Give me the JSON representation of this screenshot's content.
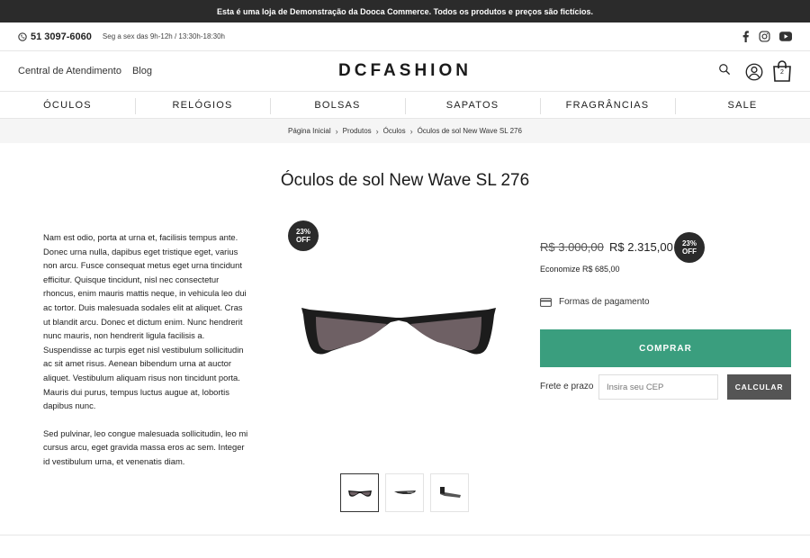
{
  "announcement": "Esta é uma loja de Demonstração da Dooca Commerce. Todos os produtos e preços são fictícios.",
  "contact": {
    "phone": "51 3097-6060",
    "hours": "Seg a sex das 9h-12h / 13:30h-18:30h"
  },
  "header": {
    "links": [
      "Central de Atendimento",
      "Blog"
    ],
    "logo": "DCFASHION",
    "cart_count": "2"
  },
  "nav": [
    "ÓCULOS",
    "RELÓGIOS",
    "BOLSAS",
    "SAPATOS",
    "FRAGRÂNCIAS",
    "SALE"
  ],
  "breadcrumb": [
    "Página Inicial",
    "Produtos",
    "Óculos",
    "Óculos de sol New Wave SL 276"
  ],
  "product": {
    "title": "Óculos de sol New Wave SL 276",
    "description": [
      "Nam est odio, porta at urna et, facilisis tempus ante. Donec urna nulla, dapibus eget tristique eget, varius non arcu. Fusce consequat metus eget urna tincidunt efficitur. Quisque tincidunt, nisl nec consectetur rhoncus, enim mauris mattis neque, in vehicula leo dui ac tortor. Duis malesuada sodales elit at aliquet. Cras ut blandit arcu. Donec et dictum enim. Nunc hendrerit nunc mauris, non hendrerit ligula facilisis a. Suspendisse ac turpis eget nisl vestibulum sollicitudin ac sit amet risus. Aenean bibendum urna at auctor aliquet. Vestibulum aliquam risus non tincidunt porta. Mauris dui purus, tempus luctus augue at, lobortis dapibus nunc.",
      "Sed pulvinar, leo congue malesuada sollicitudin, leo mi cursus arcu, eget gravida massa eros ac sem. Integer id vestibulum urna, et venenatis diam."
    ],
    "discount_percent": "23%",
    "discount_label": "OFF",
    "old_price": "R$ 3.000,00",
    "price": "R$ 2.315,00",
    "savings": "Economize R$ 685,00",
    "payment_link": "Formas de pagamento",
    "buy_label": "COMPRAR",
    "shipping_label": "Frete e prazo",
    "cep_placeholder": "Insira seu CEP",
    "calc_label": "CALCULAR"
  },
  "colors": {
    "accent": "#3a9e7e",
    "dark": "#2b2b2b",
    "calc_button": "#555555"
  },
  "icons": [
    "whatsapp-icon",
    "facebook-icon",
    "instagram-icon",
    "youtube-icon",
    "search-icon",
    "user-icon",
    "bag-icon",
    "chevron-right-icon",
    "credit-card-icon"
  ]
}
